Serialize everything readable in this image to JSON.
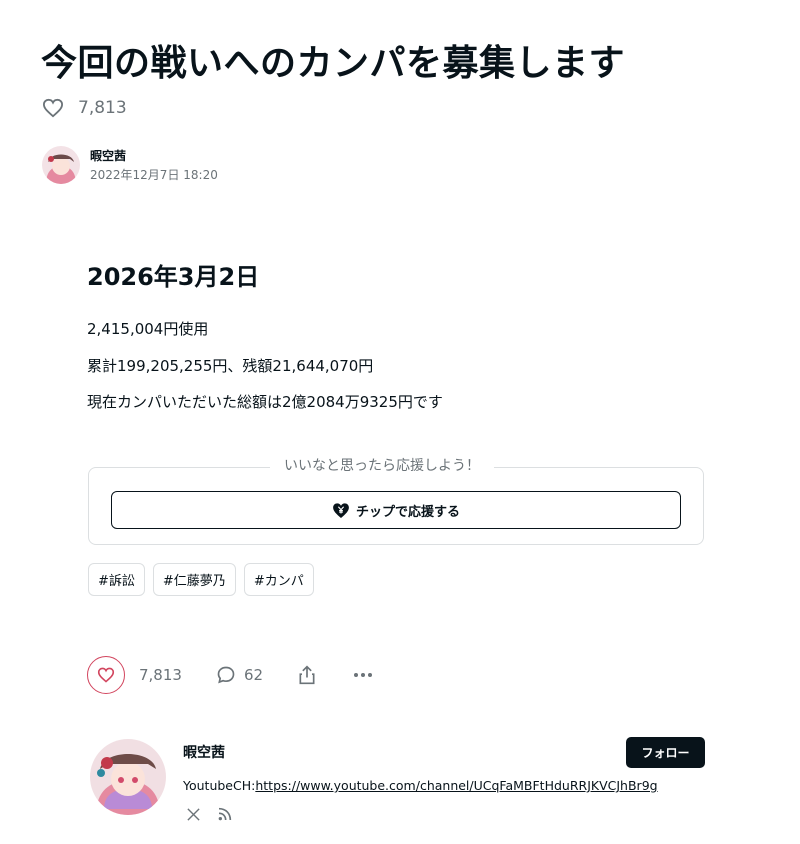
{
  "article": {
    "title": "今回の戦いへのカンパを募集します",
    "like_count": "7,813",
    "author": {
      "name": "暇空茜",
      "date": "2022年12月7日 18:20"
    }
  },
  "content": {
    "heading": "2026年3月2日",
    "lines": [
      "2,415,004円使用",
      "累計199,205,255円、残額21,644,070円",
      "現在カンパいただいた総額は2億2084万9325円です"
    ]
  },
  "support": {
    "label": "いいなと思ったら応援しよう！",
    "button_label": "チップで応援する"
  },
  "tags": [
    "#訴訟",
    "#仁藤夢乃",
    "#カンパ"
  ],
  "actions": {
    "like_count": "7,813",
    "comment_count": "62",
    "icons": [
      "heart-icon",
      "comment-icon",
      "share-icon",
      "more-icon"
    ]
  },
  "creator": {
    "name": "暇空茜",
    "follow_label": "フォロー",
    "bio_prefix": "YoutubeCH:",
    "bio_link": "https://www.youtube.com/channel/UCqFaMBFtHduRRJKVCJhBr9g",
    "social_icons": [
      "x-icon",
      "rss-icon"
    ]
  },
  "colors": {
    "text": "#08131a",
    "muted": "#6b7378",
    "like_accent": "#d2455e",
    "border": "#dcdfe1"
  }
}
